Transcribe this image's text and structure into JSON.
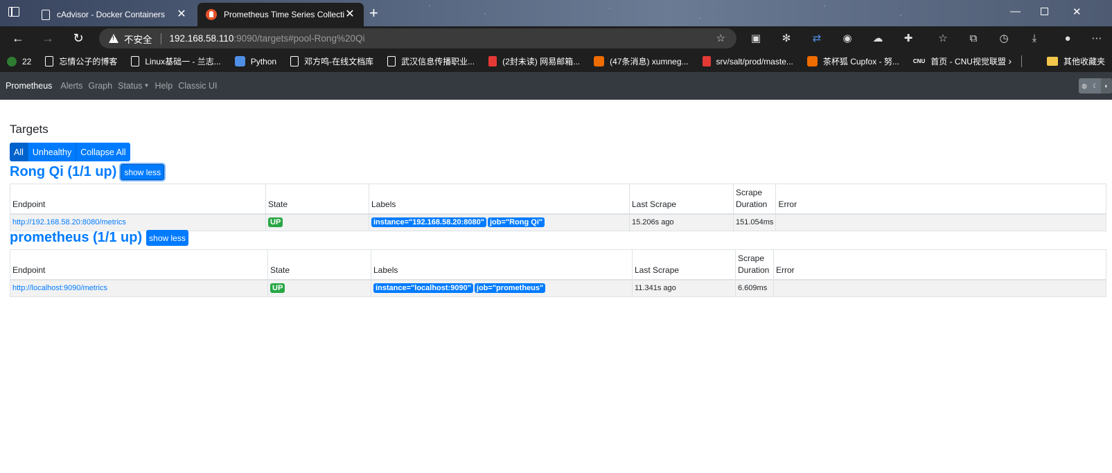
{
  "browser": {
    "tabs": [
      {
        "title": "cAdvisor - Docker Containers",
        "active": false
      },
      {
        "title": "Prometheus Time Series Collection and Processing Server",
        "active": true
      }
    ],
    "address": {
      "security_label": "不安全",
      "url_host": "192.168.58.110",
      "url_rest": ":9090/targets#pool-Rong%20Qi"
    },
    "bookmarks": [
      {
        "label": "22",
        "icon": "green"
      },
      {
        "label": "忘情公子的博客",
        "icon": "doc"
      },
      {
        "label": "Linux基础一 - 兰志...",
        "icon": "doc"
      },
      {
        "label": "Python",
        "icon": "python"
      },
      {
        "label": "邓方鸣-在线文档库",
        "icon": "doc"
      },
      {
        "label": "武汉信息传播职业...",
        "icon": "doc"
      },
      {
        "label": "(2封未读) 网易邮箱...",
        "icon": "red"
      },
      {
        "label": "(47条消息) xumneg...",
        "icon": "orange"
      },
      {
        "label": "srv/salt/prod/maste...",
        "icon": "red"
      },
      {
        "label": "茶杯狐 Cupfox - 努...",
        "icon": "orange"
      },
      {
        "label": "首页 - CNU视觉联盟",
        "icon": "cnu"
      }
    ],
    "other_bookmarks": "其他收藏夹"
  },
  "nav": {
    "brand": "Prometheus",
    "links": [
      "Alerts",
      "Graph",
      "Status",
      "Help",
      "Classic UI"
    ]
  },
  "page": {
    "title": "Targets",
    "filters": [
      "All",
      "Unhealthy",
      "Collapse All"
    ],
    "columns": {
      "endpoint": "Endpoint",
      "state": "State",
      "labels": "Labels",
      "last_scrape": "Last Scrape",
      "scrape_duration": "Scrape Duration",
      "error": "Error"
    },
    "show_less": "show less",
    "pools": [
      {
        "title": "Rong Qi (1/1 up)",
        "targets": [
          {
            "endpoint": "http://192.168.58.20:8080/metrics",
            "state": "UP",
            "labels": [
              "instance=\"192.168.58.20:8080\"",
              "job=\"Rong Qi\""
            ],
            "last_scrape": "15.206s ago",
            "scrape_duration": "151.054ms",
            "error": ""
          }
        ]
      },
      {
        "title": "prometheus (1/1 up)",
        "targets": [
          {
            "endpoint": "http://localhost:9090/metrics",
            "state": "UP",
            "labels": [
              "instance=\"localhost:9090\"",
              "job=\"prometheus\""
            ],
            "last_scrape": "11.341s ago",
            "scrape_duration": "6.609ms",
            "error": ""
          }
        ]
      }
    ]
  }
}
